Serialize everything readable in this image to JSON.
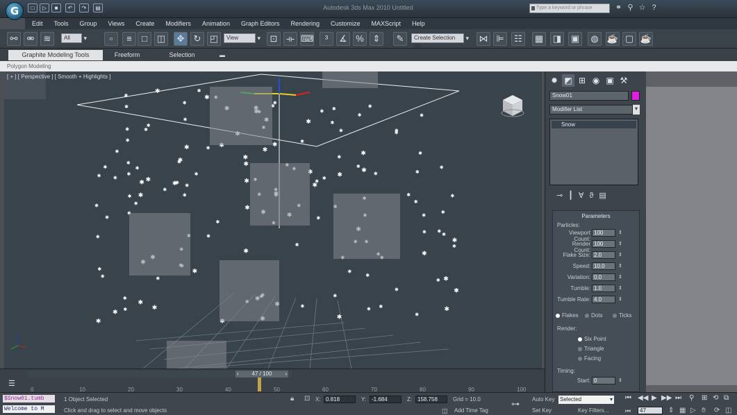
{
  "app": {
    "logo_letter": "G",
    "title": "Autodesk 3ds Max 2010    Untitled"
  },
  "quick_access": [
    "□",
    "▷",
    "■",
    "↶",
    "↷",
    "▤"
  ],
  "search": {
    "placeholder": "Type a keyword or phrase"
  },
  "info_icons": [
    "⚭",
    "⚲",
    "☆",
    "?"
  ],
  "menu": [
    "Edit",
    "Tools",
    "Group",
    "Views",
    "Create",
    "Modifiers",
    "Animation",
    "Graph Editors",
    "Rendering",
    "Customize",
    "MAXScript",
    "Help"
  ],
  "toolbar": {
    "filter": "All",
    "ref_coord": "View",
    "selection_set": "Create Selection Se"
  },
  "ribbon": {
    "tabs": [
      "Graphite Modeling Tools",
      "Freeform",
      "Selection"
    ],
    "subtitle": "Polygon Modeling"
  },
  "viewport": {
    "label": "[ + ] [ Perspective ] [ Smooth + Highlights ]"
  },
  "command_panel": {
    "object_name": "Snow01",
    "object_color": "#e020e0",
    "modifier_list": "Modifier List",
    "stack_item": "Snow",
    "params_title": "Parameters",
    "particles_label": "Particles:",
    "params": [
      {
        "label": "Viewport Count:",
        "value": "100"
      },
      {
        "label": "Render Count:",
        "value": "100"
      },
      {
        "label": "Flake Size:",
        "value": "2.0"
      },
      {
        "label": "Speed:",
        "value": "10.0"
      },
      {
        "label": "Variation:",
        "value": "0.0"
      },
      {
        "label": "Tumble:",
        "value": "1.0"
      },
      {
        "label": "Tumble Rate:",
        "value": "4.0"
      }
    ],
    "flake_types": [
      "Flakes",
      "Dots",
      "Ticks"
    ],
    "render_label": "Render:",
    "render_types": [
      "Six Point",
      "Triangle",
      "Facing"
    ],
    "timing_label": "Timing:",
    "start_label": "Start:",
    "start_value": "0"
  },
  "timeslider": {
    "current": "47 / 100",
    "frame_fraction": 0.47,
    "ticks": [
      "0",
      "10",
      "20",
      "30",
      "40",
      "50",
      "60",
      "70",
      "80",
      "90",
      "100"
    ]
  },
  "status": {
    "listener_line1": "$Snow01.tumb",
    "listener_line2": "Welcome to M",
    "selection": "1 Object Selected",
    "prompt": "Click and drag to select and move objects",
    "x_label": "X:",
    "x": "0.818",
    "y_label": "Y:",
    "y": "-1.684",
    "z_label": "Z:",
    "z": "158.758",
    "grid": "Grid = 10.0",
    "add_time_tag": "Add Time Tag",
    "auto_key": "Auto Key",
    "auto_key_mode": "Selected",
    "set_key": "Set Key",
    "key_filters": "Key Filters...",
    "frame": "47"
  }
}
